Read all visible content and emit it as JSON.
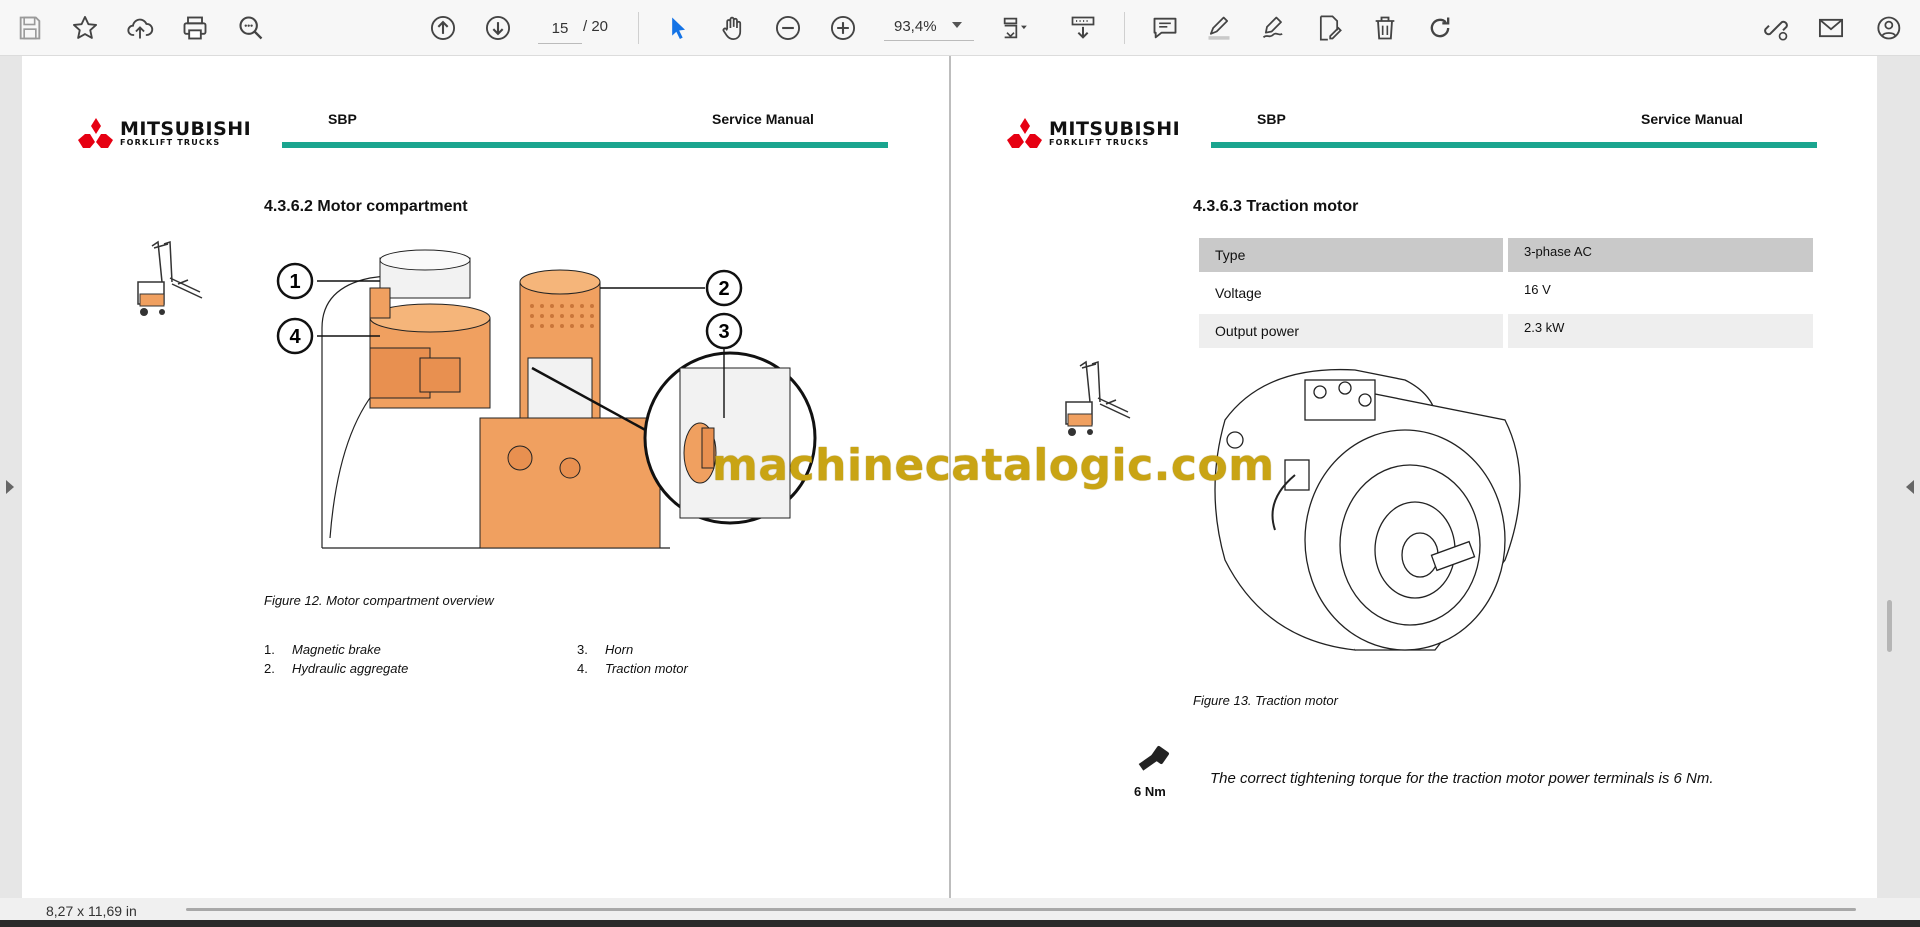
{
  "toolbar": {
    "page_current": "15",
    "page_total": "/  20",
    "zoom": "93,4%",
    "icons": [
      "save-icon",
      "bookmark-star-icon",
      "upload-cloud-icon",
      "print-icon",
      "zoom-search-icon",
      "page-up-icon",
      "page-down-icon",
      "select-cursor-icon",
      "hand-pan-icon",
      "zoom-out-icon",
      "zoom-in-icon",
      "page-fit-icon",
      "scroll-mode-icon",
      "comment-icon",
      "highlight-pen-icon",
      "draw-icon",
      "fill-sign-icon",
      "delete-icon",
      "rotate-icon",
      "share-link-icon",
      "email-icon",
      "account-icon"
    ]
  },
  "left_page": {
    "logo_main": "MITSUBISHI",
    "logo_sub": "FORKLIFT TRUCKS",
    "model": "SBP",
    "manual": "Service Manual",
    "section_title": "4.3.6.2   Motor compartment",
    "callouts": [
      "1",
      "2",
      "3",
      "4"
    ],
    "figure_caption": "Figure 12. Motor compartment overview",
    "legend": [
      {
        "num": "1.",
        "text": "Magnetic brake"
      },
      {
        "num": "2.",
        "text": "Hydraulic aggregate"
      },
      {
        "num": "3.",
        "text": "Horn"
      },
      {
        "num": "4.",
        "text": "Traction motor"
      }
    ]
  },
  "right_page": {
    "logo_main": "MITSUBISHI",
    "logo_sub": "FORKLIFT TRUCKS",
    "model": "SBP",
    "manual": "Service Manual",
    "section_title": "4.3.6.3   Traction motor",
    "spec_rows": [
      {
        "label": "Type",
        "value": "3-phase AC"
      },
      {
        "label": "Voltage",
        "value": "16 V"
      },
      {
        "label": "Output power",
        "value": "2.3 kW"
      }
    ],
    "figure_caption": "Figure 13. Traction motor",
    "torque_label": "6 Nm",
    "torque_note": "The correct tightening torque for the traction motor power terminals is 6 Nm."
  },
  "watermark": "machinecatalogic.com",
  "status": {
    "page_size": "8,27 x 11,69 in"
  },
  "colors": {
    "accent_rule": "#1aa58f",
    "logo_red": "#e60012",
    "component_orange": "#f0a060",
    "watermark": "#c9a414",
    "select_blue": "#1473e6"
  }
}
